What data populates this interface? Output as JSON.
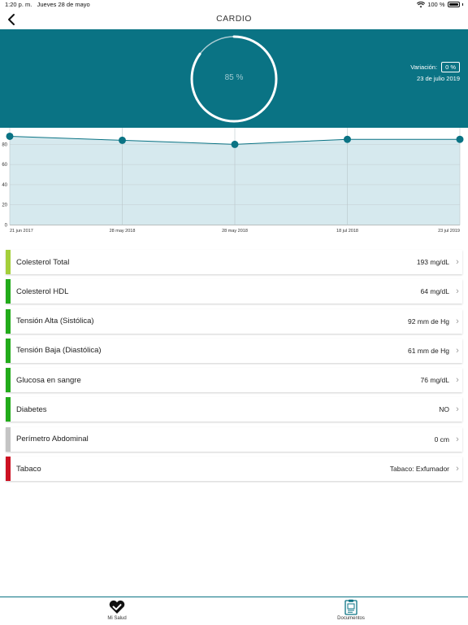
{
  "status": {
    "time": "1:20 p. m.",
    "date": "Jueves 28 de mayo",
    "battery": "100 %"
  },
  "nav": {
    "title": "CARDIO"
  },
  "hero": {
    "percent_label": "85 %",
    "percent_value": 85,
    "variation_label": "Variación:",
    "variation_value": "0 %",
    "date": "23 de julio 2019",
    "colors": {
      "background": "#0a7384",
      "ring": "#ffffff",
      "ring_track": "#a9cbd2"
    }
  },
  "chart_data": {
    "type": "area",
    "x": [
      "21 jun 2017",
      "28 may 2018",
      "28 may 2018",
      "18 jul 2018",
      "23 jul 2019"
    ],
    "values": [
      88,
      84,
      80,
      85,
      85
    ],
    "ylim": [
      0,
      90
    ],
    "yticks": [
      0,
      20,
      40,
      60,
      80
    ],
    "grid": true,
    "colors": {
      "line": "#0a7384",
      "fill": "#d6e9ee",
      "point": "#0a7384"
    }
  },
  "metrics": [
    {
      "name": "Colesterol Total",
      "value": "193 mg/dL",
      "color": "#a4cf3a"
    },
    {
      "name": "Colesterol HDL",
      "value": "64 mg/dL",
      "color": "#22ab1a"
    },
    {
      "name": "Tensión Alta (Sistólica)",
      "value": "92 mm de Hg",
      "color": "#22ab1a"
    },
    {
      "name": "Tensión Baja (Diastólica)",
      "value": "61 mm de Hg",
      "color": "#22ab1a"
    },
    {
      "name": "Glucosa en sangre",
      "value": "76 mg/dL",
      "color": "#22ab1a"
    },
    {
      "name": "Diabetes",
      "value": "NO",
      "color": "#22ab1a"
    },
    {
      "name": "Perímetro Abdominal",
      "value": "0 cm",
      "color": "#c4c4c4"
    },
    {
      "name": "Tabaco",
      "value": "Tabaco: Exfumador",
      "color": "#cc1122"
    }
  ],
  "tabs": [
    {
      "label": "Mi Salud",
      "icon": "heart-check-icon"
    },
    {
      "label": "Documentos",
      "icon": "clipboard-icon"
    }
  ]
}
